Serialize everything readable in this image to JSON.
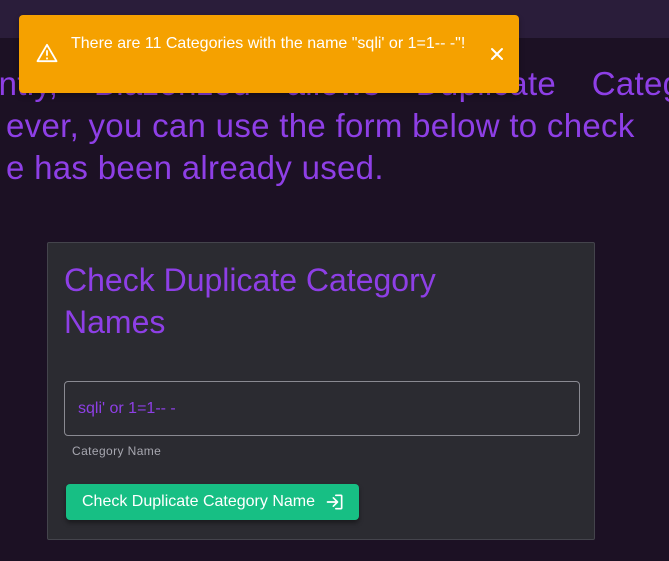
{
  "intro": {
    "line1_words": [
      "ently,",
      "Blazorized",
      "allows",
      "Duplicate",
      "Catego"
    ],
    "line2": "ever, you can use the form below to check",
    "line3": "e has been already used."
  },
  "card": {
    "title": "Check Duplicate Category Names",
    "input_value": "sqli' or 1=1-- -",
    "input_helper": "Category Name",
    "submit_label": "Check Duplicate Category Name",
    "submit_icon": "login-icon"
  },
  "toast": {
    "message": "There are 11 Categories with the name \"sqli' or 1=1-- -\"!",
    "icon": "warning-icon",
    "close_icon": "close-icon",
    "color": "#f5a100"
  },
  "colors": {
    "accent": "#8e3fe6",
    "button": "#17bf84",
    "background": "#1c1124",
    "card": "#2b2b31"
  }
}
